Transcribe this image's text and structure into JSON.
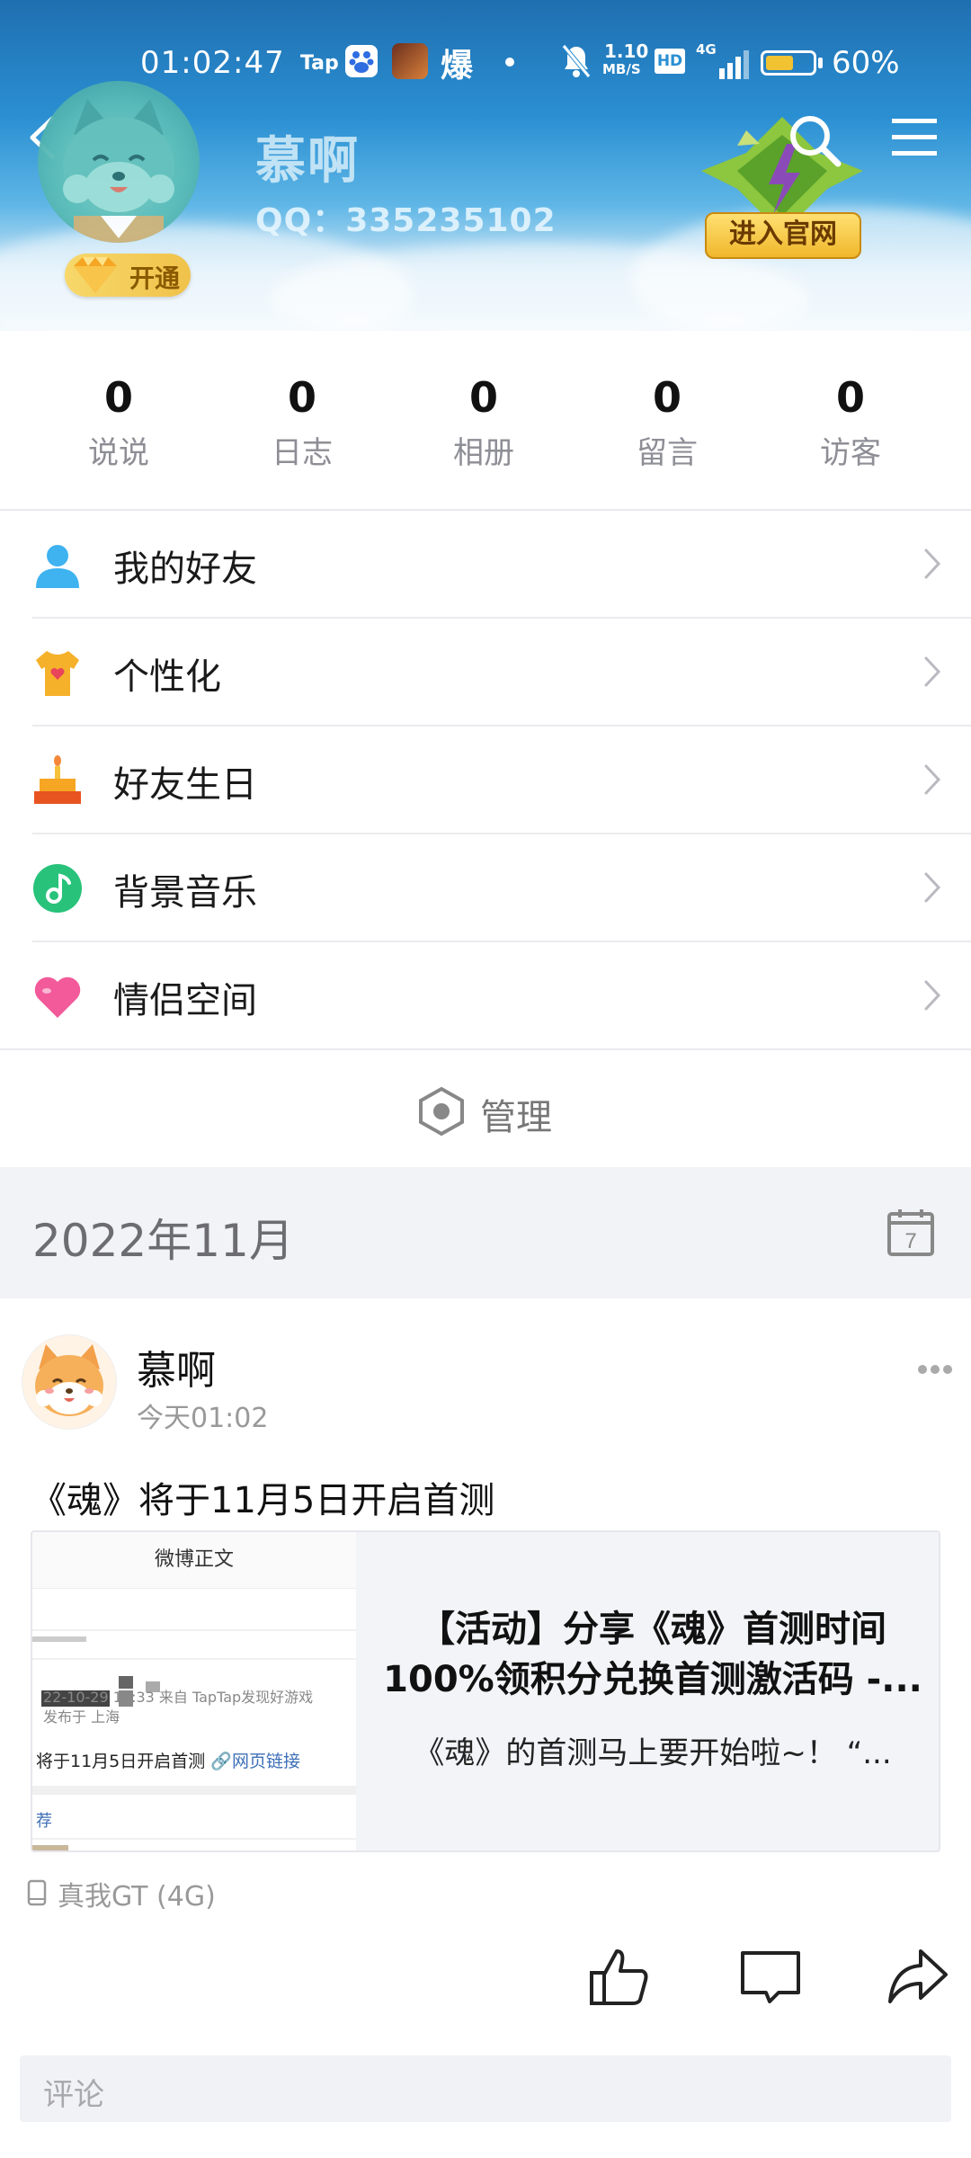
{
  "status_bar": {
    "time": "01:02:47",
    "tap_label": "Tap",
    "hot_label": "爆",
    "net_speed": "1.10",
    "net_unit": "MB/S",
    "hd_label": "HD",
    "signal_label": "4G",
    "battery_percent": "60%",
    "battery_level": 0.6
  },
  "profile": {
    "name": "慕啊",
    "qq": "QQ：335235102",
    "vip_label": "开通",
    "official_button": "进入官网"
  },
  "stats": [
    {
      "count": "0",
      "label": "说说"
    },
    {
      "count": "0",
      "label": "日志"
    },
    {
      "count": "0",
      "label": "相册"
    },
    {
      "count": "0",
      "label": "留言"
    },
    {
      "count": "0",
      "label": "访客"
    }
  ],
  "menu": [
    {
      "label": "我的好友",
      "icon": "friends-icon",
      "color": "#3fb2f0"
    },
    {
      "label": "个性化",
      "icon": "tshirt-icon",
      "color": "#f5b12a"
    },
    {
      "label": "好友生日",
      "icon": "cake-icon",
      "color": "#f6a623"
    },
    {
      "label": "背景音乐",
      "icon": "music-icon",
      "color": "#28c27a"
    },
    {
      "label": "情侣空间",
      "icon": "heart-icon",
      "color": "#f25a9a"
    }
  ],
  "manage_label": "管理",
  "feed": {
    "month": "2022年11月",
    "calendar_day": "7",
    "post": {
      "author": "慕啊",
      "time": "今天01:02",
      "text": "《魂》将于11月5日开启首测",
      "card": {
        "thumb_header": "微博正文",
        "thumb_meta1": "22-10-29 10:33  来自 TapTap发现好游戏",
        "thumb_meta2": "发布于 上海",
        "thumb_body": "将于11月5日开启首测",
        "thumb_link": "🔗网页链接",
        "thumb_rec": "荐",
        "title": "【活动】分享《魂》首测时间100%领积分兑换首测激活码 -...",
        "desc": "《魂》的首测马上要开始啦~！ “..."
      },
      "device": "真我GT (4G)",
      "comment_placeholder": "评论"
    }
  }
}
